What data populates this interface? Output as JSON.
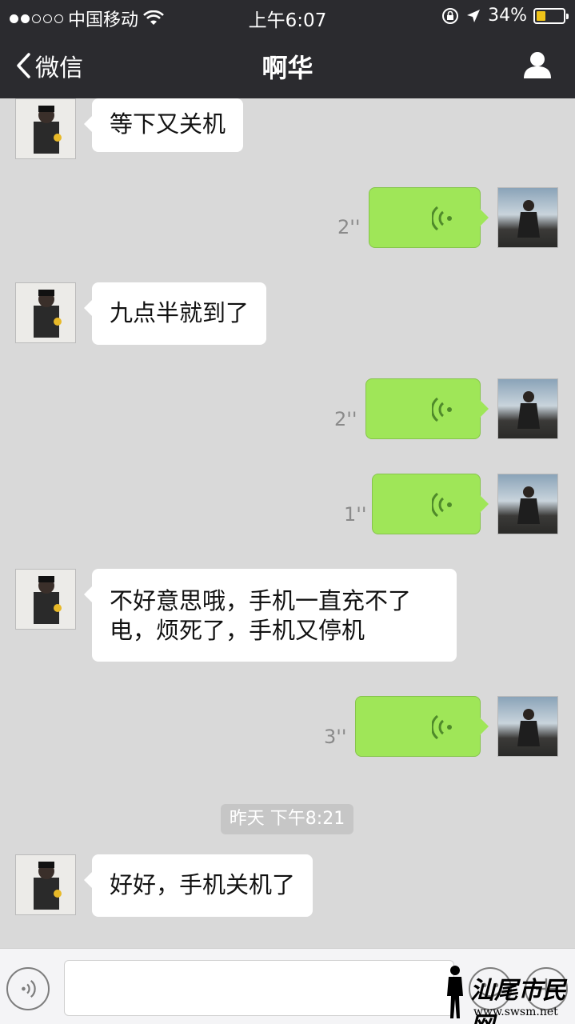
{
  "status_bar": {
    "carrier": "中国移动",
    "time": "上午6:07",
    "battery": "34%",
    "battery_level": 0.34,
    "signal_dots_filled": 2,
    "signal_dots_total": 5
  },
  "nav": {
    "back_label": "微信",
    "title": "啊华"
  },
  "messages": [
    {
      "side": "friend",
      "type": "text",
      "text": "等下又关机"
    },
    {
      "side": "me",
      "type": "voice",
      "duration": "2''"
    },
    {
      "side": "friend",
      "type": "text",
      "text": "九点半就到了"
    },
    {
      "side": "me",
      "type": "voice",
      "duration": "2''"
    },
    {
      "side": "me",
      "type": "voice",
      "duration": "1''"
    },
    {
      "side": "friend",
      "type": "text",
      "text": "不好意思哦，手机一直充不了电，烦死了，手机又停机"
    },
    {
      "side": "me",
      "type": "voice",
      "duration": "3''"
    },
    {
      "type": "timestamp",
      "text": "昨天 下午8:21"
    },
    {
      "side": "friend",
      "type": "text",
      "text": "好好，手机关机了"
    }
  ],
  "input": {
    "value": "",
    "placeholder": ""
  },
  "watermark": {
    "text": "汕尾市民网",
    "url": "www.swsm.net"
  },
  "colors": {
    "nav_bg": "#2b2b2f",
    "chat_bg": "#d9d9d9",
    "my_bubble": "#9fe658",
    "friend_bubble": "#ffffff",
    "battery_fill": "#f0c419"
  },
  "icons": [
    "wifi-icon",
    "lock-rotation-icon",
    "location-arrow-icon",
    "battery-icon",
    "back-chevron-icon",
    "profile-icon",
    "voice-wave-icon",
    "voice-input-icon",
    "emoji-icon",
    "plus-icon"
  ]
}
